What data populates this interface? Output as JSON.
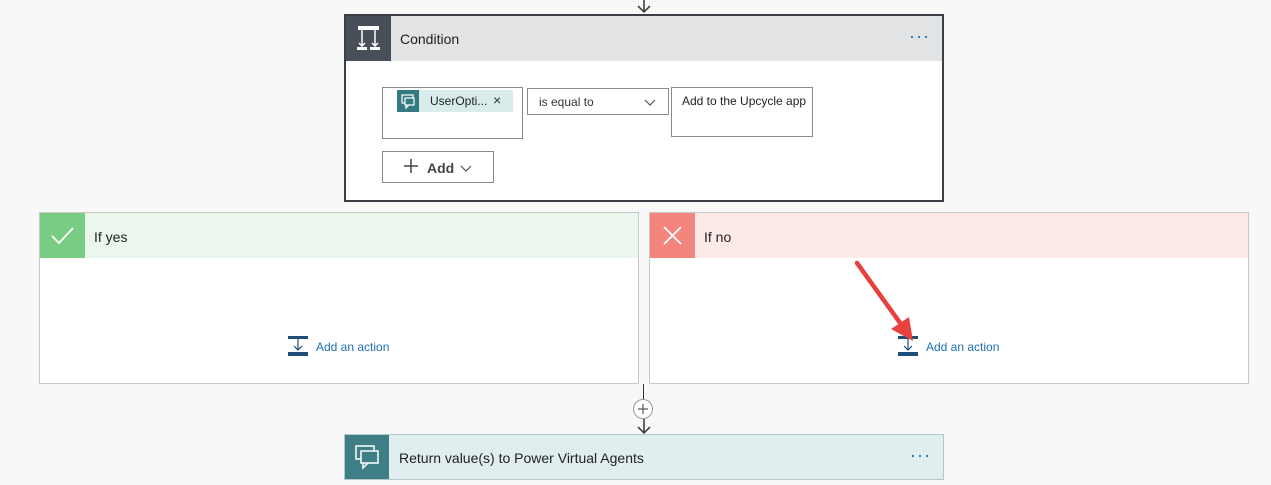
{
  "condition": {
    "title": "Condition",
    "more_label": "···",
    "token_label": "UserOpti...",
    "token_remove": "×",
    "operator": "is equal to",
    "value": "Add to the Upcycle app",
    "add_label": "Add"
  },
  "branch_yes": {
    "title": "If yes",
    "add_action_label": "Add an action"
  },
  "branch_no": {
    "title": "If no",
    "add_action_label": "Add an action"
  },
  "return_action": {
    "title": "Return value(s) to Power Virtual Agents",
    "more_label": "···"
  },
  "colors": {
    "accent_link": "#1f6fb5",
    "condition_icon_bg": "#484f58",
    "yes_green": "#79cd83",
    "no_red": "#f4857d",
    "pva_teal": "#3d7f85",
    "annotation_arrow": "#e8403f"
  },
  "icons": {
    "condition": "condition-icon",
    "token": "chat-bot-icon",
    "yes": "check-icon",
    "no": "close-icon",
    "add_action": "add-action-icon",
    "insert": "plus-icon",
    "return": "chat-bot-icon"
  }
}
